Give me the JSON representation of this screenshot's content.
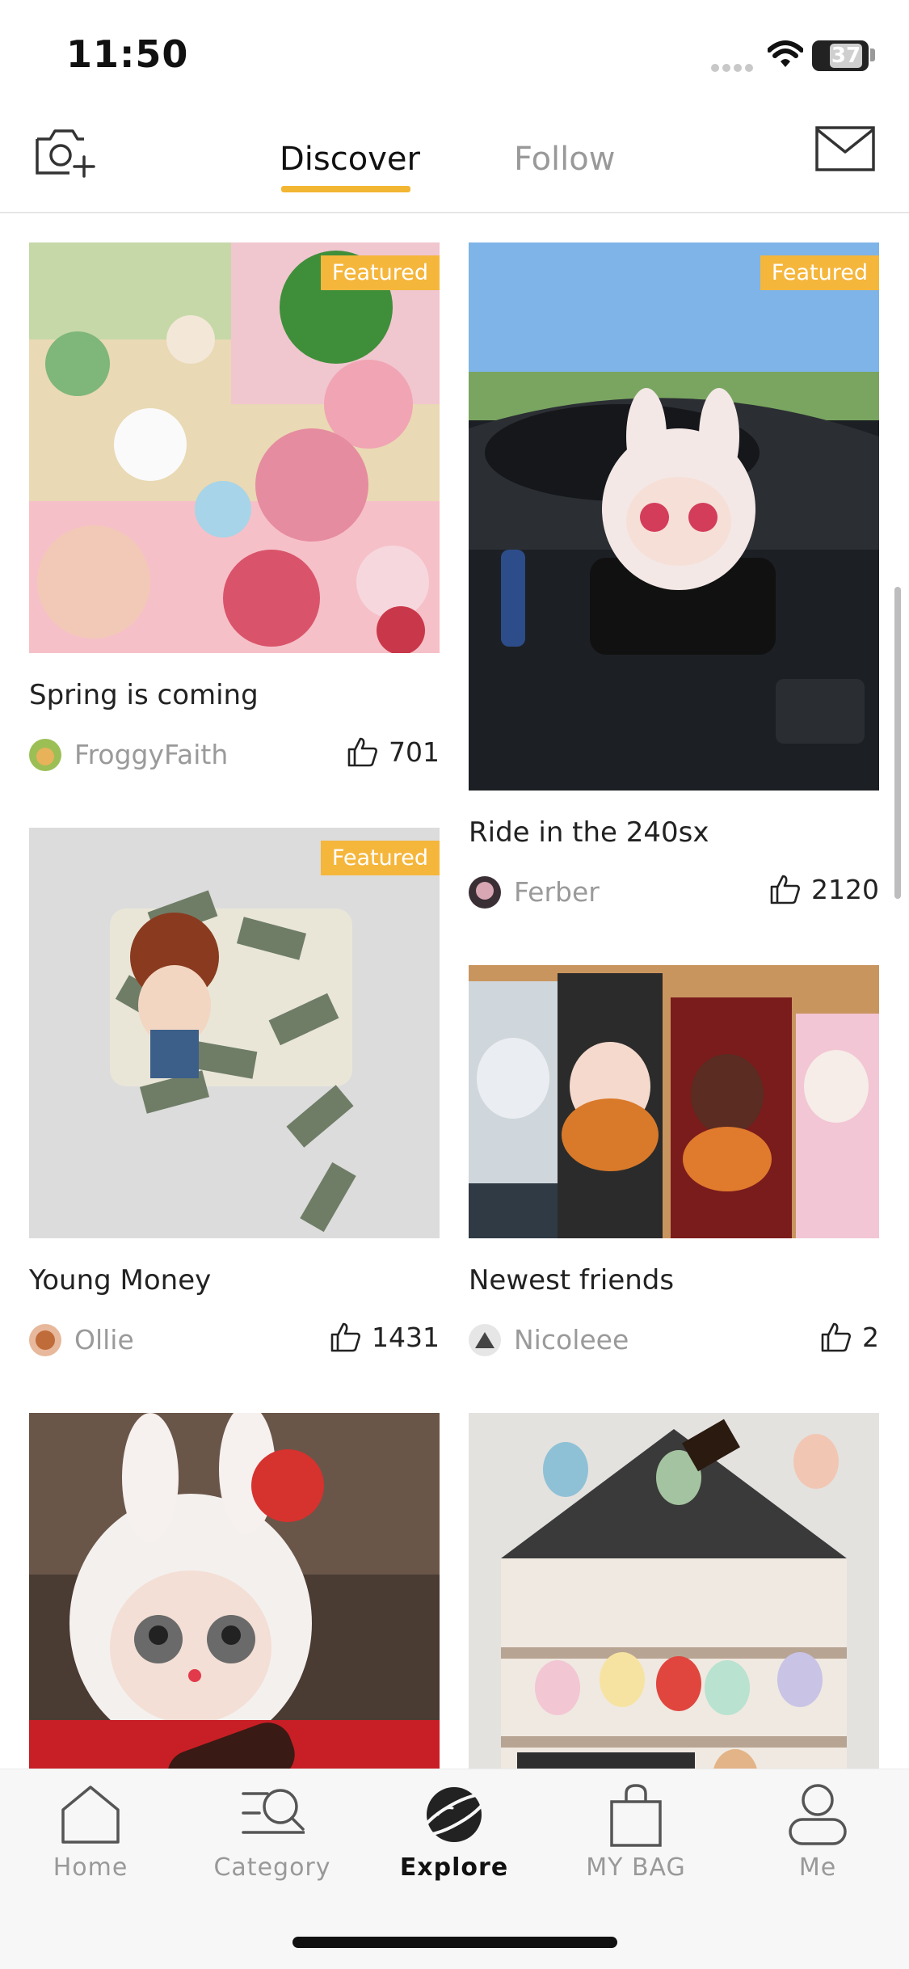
{
  "status_bar": {
    "time": "11:50",
    "battery": "37",
    "icons": [
      "signal-dots-icon",
      "wifi-icon",
      "battery-icon"
    ]
  },
  "top_nav": {
    "tabs": [
      {
        "label": "Discover",
        "active": true
      },
      {
        "label": "Follow",
        "active": false
      }
    ],
    "left_icon": "camera-plus-icon",
    "right_icon": "mail-icon",
    "accent_color": "#f2b632"
  },
  "feed": {
    "left_column": [
      {
        "title": "Spring is coming",
        "user": "FroggyFaith",
        "likes": "701",
        "badge": "Featured"
      },
      {
        "title": "Young Money",
        "user": "Ollie",
        "likes": "1431",
        "badge": "Featured"
      },
      {
        "title": "",
        "user": "",
        "likes": "",
        "badge": ""
      }
    ],
    "right_column": [
      {
        "title": "Ride in the 240sx",
        "user": "Ferber",
        "likes": "2120",
        "badge": "Featured"
      },
      {
        "title": "Newest friends",
        "user": "Nicoleee",
        "likes": "2",
        "badge": ""
      },
      {
        "title": "",
        "user": "",
        "likes": "",
        "badge": ""
      }
    ],
    "badge_color": "#f5b63c",
    "like_icon": "thumbs-up-icon"
  },
  "tabbar": {
    "items": [
      {
        "label": "Home",
        "icon": "home-icon",
        "active": false
      },
      {
        "label": "Category",
        "icon": "category-search-icon",
        "active": false
      },
      {
        "label": "Explore",
        "icon": "planet-icon",
        "active": true
      },
      {
        "label": "MY BAG",
        "icon": "shopping-bag-icon",
        "active": false
      },
      {
        "label": "Me",
        "icon": "person-icon",
        "active": false
      }
    ]
  }
}
